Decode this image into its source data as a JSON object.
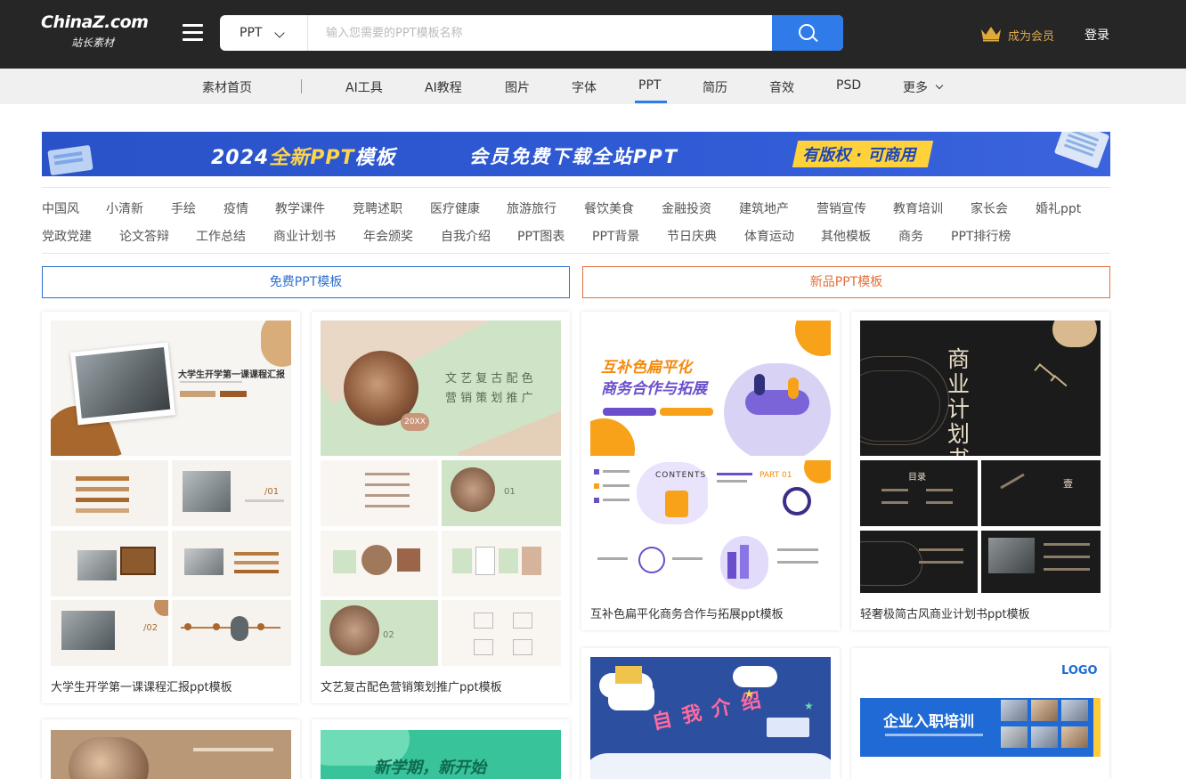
{
  "header": {
    "logo_brand_a": "China",
    "logo_brand_z": "Z",
    "logo_brand_b": ".com",
    "logo_sub": "站长素材",
    "search_type": "PPT",
    "search_placeholder": "输入您需要的PPT模板名称",
    "vip_label": "成为会员",
    "login_label": "登录"
  },
  "nav": {
    "items": [
      "素材首页",
      "AI工具",
      "AI教程",
      "图片",
      "字体",
      "PPT",
      "简历",
      "音效",
      "PSD",
      "更多"
    ],
    "active": "PPT"
  },
  "banner": {
    "year_text": "2024",
    "highlight_text": "全新PPT",
    "suffix_text": "模板",
    "middle_text": "会员免费下载全站PPT",
    "tag_text": "有版权 · 可商用"
  },
  "tags": {
    "row1": [
      "中国风",
      "小清新",
      "手绘",
      "疫情",
      "教学课件",
      "竞聘述职",
      "医疗健康",
      "旅游旅行",
      "餐饮美食",
      "金融投资",
      "建筑地产",
      "营销宣传",
      "教育培训",
      "家长会",
      "婚礼ppt"
    ],
    "row2": [
      "党政党建",
      "论文答辩",
      "工作总结",
      "商业计划书",
      "年会颁奖",
      "自我介绍",
      "PPT图表",
      "PPT背景",
      "节日庆典",
      "体育运动",
      "其他模板",
      "商务",
      "PPT排行榜"
    ]
  },
  "toggles": {
    "free": "免费PPT模板",
    "new": "新品PPT模板"
  },
  "cards": [
    {
      "caption": "大学生开学第一课课程汇报ppt模板",
      "slide_title": "大学生开学第一课课程汇报",
      "slide_sub": "/01",
      "slide_sub2": "/02"
    },
    {
      "caption": "文艺复古配色营销策划推广ppt模板",
      "slide_title_a": "文 艺 复 古 配 色",
      "slide_title_b": "营 销 策 划 推 广",
      "slide_badge": "20XX"
    },
    {
      "caption": "互补色扁平化商务合作与拓展ppt模板",
      "slide_title_a": "互补色扁平化",
      "slide_title_b": "商务合作与拓展",
      "slide_contents": "CONTENTS",
      "slide_part": "PART 01"
    },
    {
      "caption": "轻奢极简古风商业计划书ppt模板",
      "slide_title": "商业计划书",
      "slide_toc": "目录",
      "slide_num": "壹"
    },
    {
      "caption": "",
      "slide_title": "自我介绍"
    },
    {
      "caption": "",
      "slide_logo": "LOGO",
      "slide_title": "企业入职培训"
    },
    {
      "caption": "",
      "slide_title": "新学期，新开始"
    }
  ],
  "colors": {
    "topbar": "#262626",
    "accent_blue": "#2f7bea",
    "vip_gold": "#d8a94f",
    "new_orange": "#e0703a"
  }
}
